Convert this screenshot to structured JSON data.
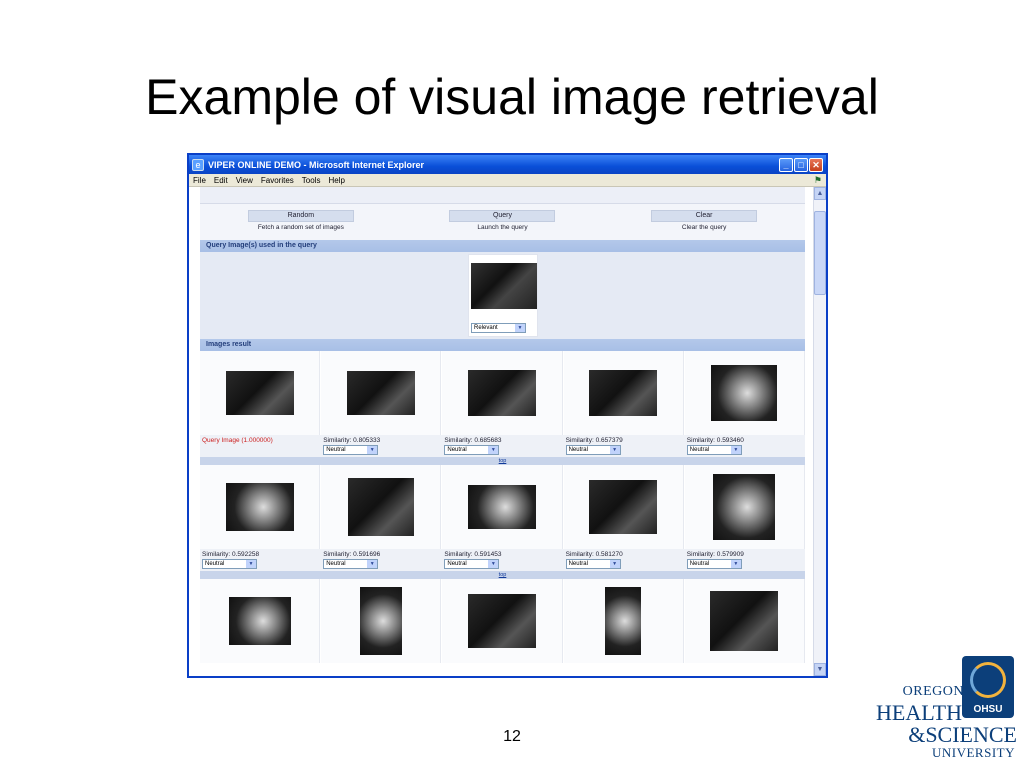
{
  "slide": {
    "title": "Example of visual image retrieval",
    "page_number": "12"
  },
  "window": {
    "title": "VIPER ONLINE DEMO - Microsoft Internet Explorer",
    "menu": [
      "File",
      "Edit",
      "View",
      "Favorites",
      "Tools",
      "Help"
    ]
  },
  "actions": [
    {
      "label": "Random",
      "desc": "Fetch a random set of images"
    },
    {
      "label": "Query",
      "desc": "Launch the query"
    },
    {
      "label": "Clear",
      "desc": "Clear the query"
    }
  ],
  "query_section": {
    "header": "Query Image(s) used in the query",
    "relevance": "Relevant"
  },
  "results_section": {
    "header": "Images result",
    "top_link": "top",
    "rows": [
      [
        {
          "caption": "Query Image (1.000000)",
          "select": ""
        },
        {
          "caption": "Similarity: 0.805333",
          "select": "Neutral"
        },
        {
          "caption": "Similarity: 0.685683",
          "select": "Neutral"
        },
        {
          "caption": "Similarity: 0.657379",
          "select": "Neutral"
        },
        {
          "caption": "Similarity: 0.593460",
          "select": "Neutral"
        }
      ],
      [
        {
          "caption": "Similarity: 0.592258",
          "select": "Neutral"
        },
        {
          "caption": "Similarity: 0.591696",
          "select": "Neutral"
        },
        {
          "caption": "Similarity: 0.591453",
          "select": "Neutral"
        },
        {
          "caption": "Similarity: 0.581270",
          "select": "Neutral"
        },
        {
          "caption": "Similarity: 0.579909",
          "select": "Neutral"
        }
      ]
    ]
  },
  "logo": {
    "line1": "OREGON",
    "line2": "HEALTH",
    "line3": "&SCIENCE",
    "line4": "UNIVERSITY",
    "emblem": "OHSU"
  },
  "colors": {
    "section_bar": "#a8bfe6",
    "query_caption": "#cc2020",
    "link": "#123a9a",
    "brand": "#0c3f7a"
  },
  "icons": [
    "ie-logo-icon",
    "minimize-icon",
    "maximize-icon",
    "close-icon",
    "windows-flag-icon",
    "chevron-down-icon",
    "scroll-up-icon",
    "scroll-down-icon"
  ]
}
